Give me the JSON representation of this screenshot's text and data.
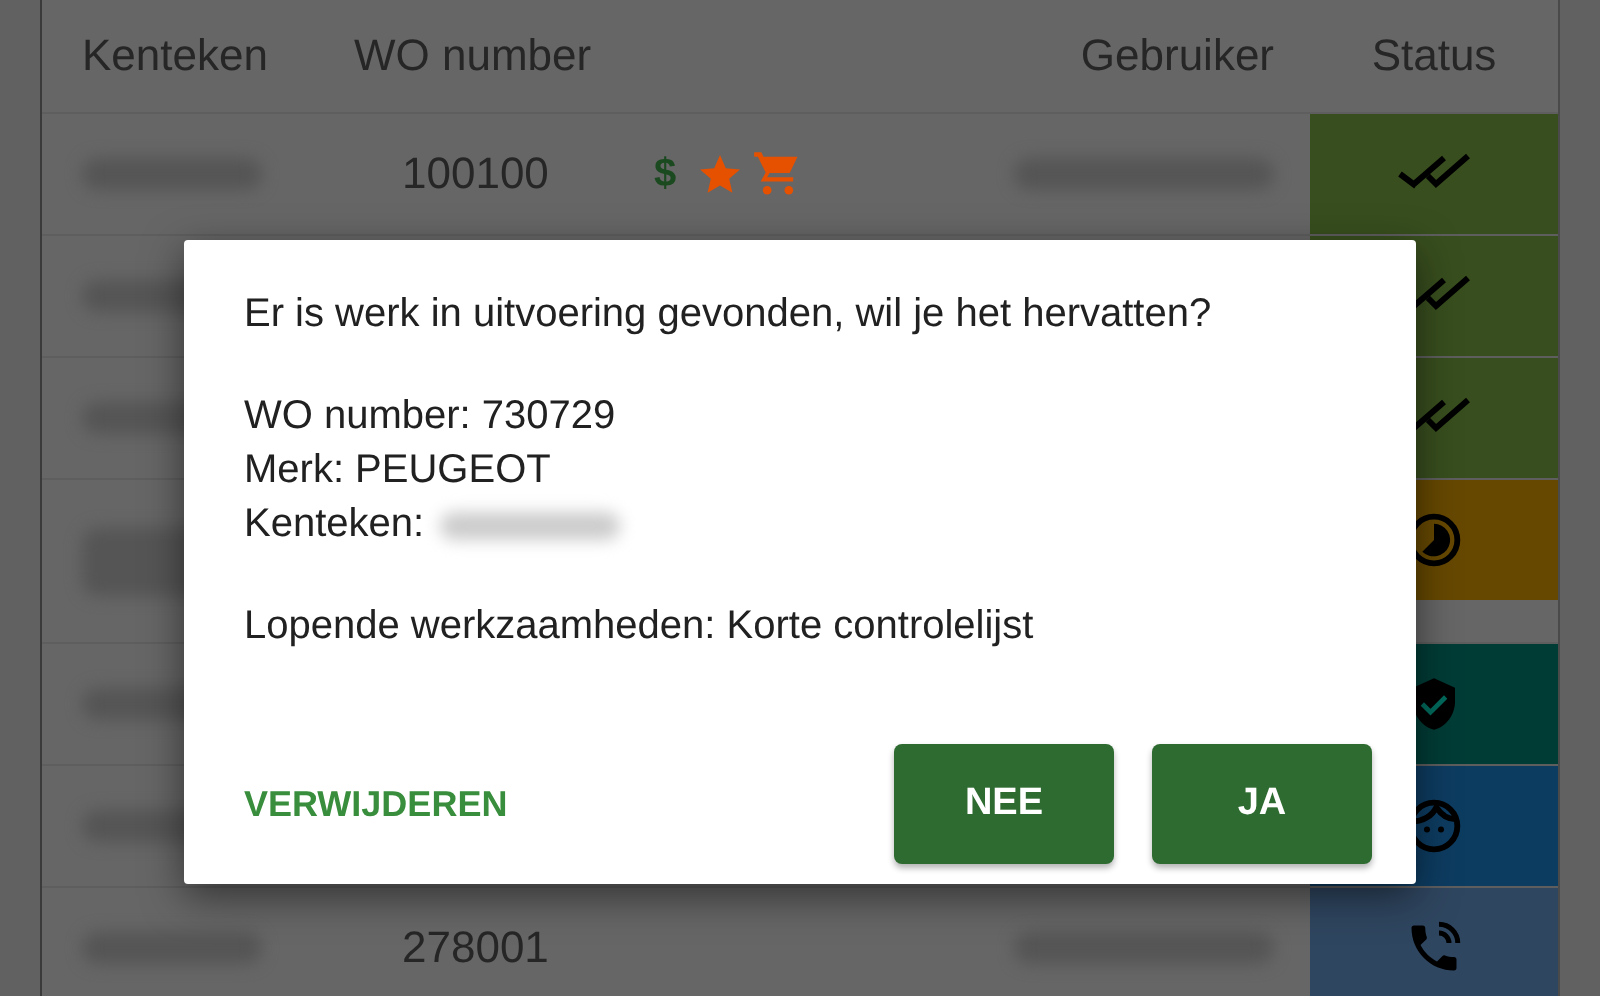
{
  "table": {
    "columns": [
      "Kenteken",
      "WO number",
      "Gebruiker",
      "Status"
    ],
    "rows": [
      {
        "wo_number": "100100",
        "marker": "$",
        "flags": [
          {
            "kind": "star"
          },
          {
            "kind": "cart"
          }
        ],
        "kind": "done",
        "color": "#384e1e"
      },
      {
        "kind": "done",
        "color": "#384e1e"
      },
      {
        "kind": "done",
        "color": "#384e1e"
      },
      {
        "kind": "pending",
        "color": "#664800"
      },
      {
        "kind": "verified",
        "color": "#003c36"
      },
      {
        "kind": "customer",
        "color": "#0d3c61"
      },
      {
        "wo_number": "278001",
        "kind": "call",
        "color": "#2f4660"
      }
    ]
  },
  "dialog": {
    "message": "Er is werk in uitvoering gevonden, wil je het hervatten?",
    "details": [
      {
        "text": "WO number: 730729"
      },
      {
        "text": "Merk: PEUGEOT"
      },
      {
        "text": "Kenteken:",
        "kind": "blurred"
      }
    ],
    "activity": "Lopende werkzaamheden: Korte controlelijst",
    "delete_label": "VERWIJDEREN",
    "buttons": [
      "NEE",
      "JA"
    ]
  }
}
